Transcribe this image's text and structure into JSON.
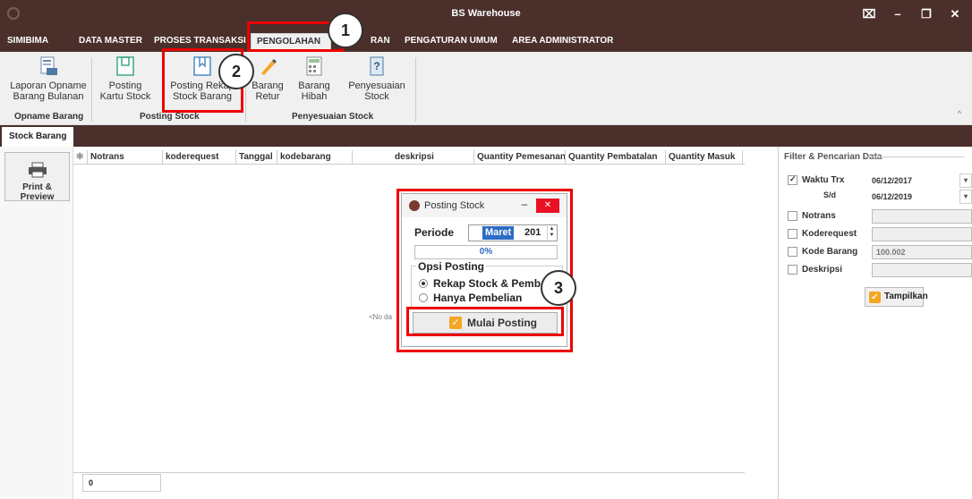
{
  "window": {
    "title": "BS Warehouse",
    "controls": [
      "⌧",
      "–",
      "❐",
      "✕"
    ]
  },
  "menu": {
    "tabs": [
      {
        "label": "SIMIBIMA"
      },
      {
        "label": "DATA MASTER"
      },
      {
        "label": "PROSES TRANSAKSI"
      },
      {
        "label": "PENGOLAHAN"
      },
      {
        "label": "RAN"
      },
      {
        "label": "PENGATURAN UMUM"
      },
      {
        "label": "AREA ADMINISTRATOR"
      }
    ],
    "active": "PENGOLAHAN"
  },
  "ribbon": {
    "buttons": [
      {
        "line1": "Laporan Opname",
        "line2": "Barang Bulanan"
      },
      {
        "line1": "Posting",
        "line2": "Kartu Stock"
      },
      {
        "line1": "Posting Rekap",
        "line2": "Stock Barang"
      },
      {
        "line1": "Barang",
        "line2": "Retur"
      },
      {
        "line1": "Barang",
        "line2": "Hibah"
      },
      {
        "line1": "Penyesuaian",
        "line2": "Stock"
      }
    ],
    "groups": [
      "Opname Barang",
      "Posting Stock",
      "Penyesuaian Stock"
    ],
    "collapse": "^"
  },
  "doc_tab": "Stock Barang",
  "left_panel": {
    "print_label": "Print & Preview"
  },
  "grid": {
    "columns": [
      "Notrans",
      "koderequest",
      "Tanggal",
      "kodebarang",
      "deskripsi",
      "Quantity Pemesanan",
      "Quantity Pembatalan",
      "Quantity Masuk"
    ],
    "empty_text": "<No da",
    "footer_count": "0"
  },
  "filter": {
    "title": "Filter & Pencarian Data",
    "waktu_trx": {
      "label": "Waktu Trx",
      "checked": true,
      "from": "06/12/2017",
      "sd_label": "S/d",
      "to": "06/12/2019"
    },
    "notrans": {
      "label": "Notrans",
      "checked": false,
      "value": ""
    },
    "koderequest": {
      "label": "Koderequest",
      "checked": false,
      "value": ""
    },
    "kode_barang": {
      "label": "Kode Barang",
      "checked": false,
      "value": "100.002"
    },
    "deskripsi": {
      "label": "Deskripsi",
      "checked": false,
      "value": ""
    },
    "button_label": "Tampilkan"
  },
  "dialog": {
    "title": "Posting Stock",
    "periode_label": "Periode",
    "month": "Maret",
    "year": "201",
    "progress_text": "0%",
    "progress_value": 0,
    "opsi_label": "Opsi Posting",
    "options": [
      "Rekap Stock & Pemb",
      "Hanya Pembelian"
    ],
    "selected_option": 0,
    "button_label": "Mulai Posting"
  },
  "annotations": [
    "1",
    "2",
    "3"
  ],
  "colors": {
    "titlebar": "#4a2f2a",
    "highlight": "#e00000",
    "accent": "#2b6cc4",
    "check": "#f5a623"
  }
}
